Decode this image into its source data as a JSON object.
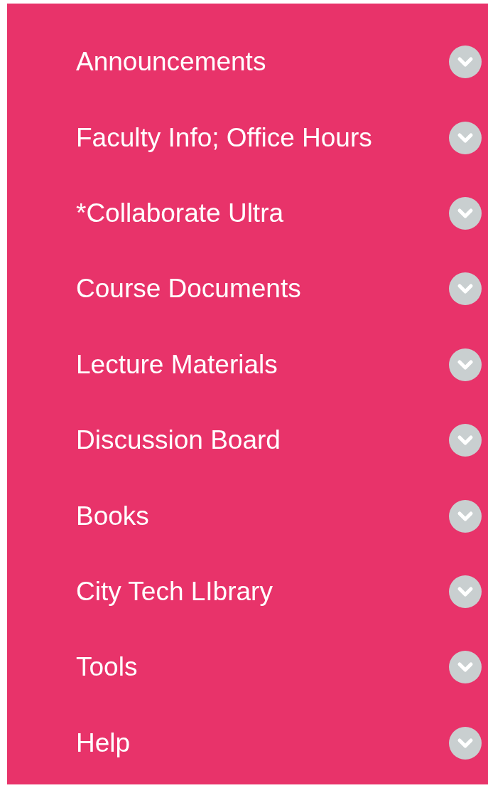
{
  "menu": {
    "items": [
      {
        "label": "Announcements"
      },
      {
        "label": "Faculty Info; Office Hours"
      },
      {
        "label": "*Collaborate Ultra"
      },
      {
        "label": "Course Documents"
      },
      {
        "label": "Lecture Materials"
      },
      {
        "label": "Discussion Board"
      },
      {
        "label": "Books"
      },
      {
        "label": "City Tech LIbrary"
      },
      {
        "label": "Tools"
      },
      {
        "label": "Help"
      }
    ]
  }
}
